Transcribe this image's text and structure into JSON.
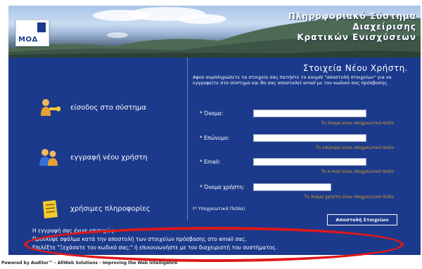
{
  "header": {
    "logo_text": "ΜΟΔ",
    "title_lines": [
      "Πληροφοριακό Σύστημα",
      "Διαχείρισης",
      "Κρατικών Ενισχύσεων"
    ]
  },
  "nav": {
    "items": [
      {
        "label": "είσοδος στο σύστημα",
        "icon": "key-person-icon"
      },
      {
        "label": "εγγραφή νέου χρήστη",
        "icon": "users-icon"
      },
      {
        "label": "χρήσιμες πληροφορίες",
        "icon": "notepad-icon"
      }
    ]
  },
  "form": {
    "title": "Στοιχεία Νέου Χρήστη.",
    "intro": "Αφού συμπληρώσετε τα στοιχεία σας πατήστε το κουμπί \"αποστολή στοιχείων\" για να εγγραφείτε στο σύστημα και θα σας αποσταλεί email με τον κωδικό σας πρόσβασης.",
    "fields": [
      {
        "label": "* Όνομα:",
        "value": "",
        "hint": "Το όνομα είναι υποχρεωτικό πεδίο"
      },
      {
        "label": "* Επώνυμο:",
        "value": "",
        "hint": "Το επώνυμο είναι υποχρεωτικό πεδίο"
      },
      {
        "label": "* Email:",
        "value": "",
        "hint": "Το e-mail είναι υποχρεωτικό πεδίο"
      },
      {
        "label": "* Όνομα χρήστη:",
        "value": "",
        "hint": "Το όνομα χρήστη είναι υποχρεωτικό πεδίο"
      }
    ],
    "required_note": "(* Υποχρεωτικά Πεδία)",
    "submit_label": "Αποστολή Στοιχείων"
  },
  "messages": [
    "Η εγγραφή σας έγινε επιτυχώς.",
    "Προέκυψε σφάλμα κατά την αποστολή των στοιχείων πρόσβασης στο email σας.",
    "Επιλέξτε \"Ξεχάσατε τον κωδικό σας;\" ή επικοινωνήστε με τον διαχειριστή του συστήματος."
  ],
  "footer": "Powered by Auditor™ - AllWeb Solutions - Improving the Web Intelligence",
  "colors": {
    "panel": "#1c3a8c",
    "hint": "#d6a020",
    "highlight": "#e01818"
  }
}
